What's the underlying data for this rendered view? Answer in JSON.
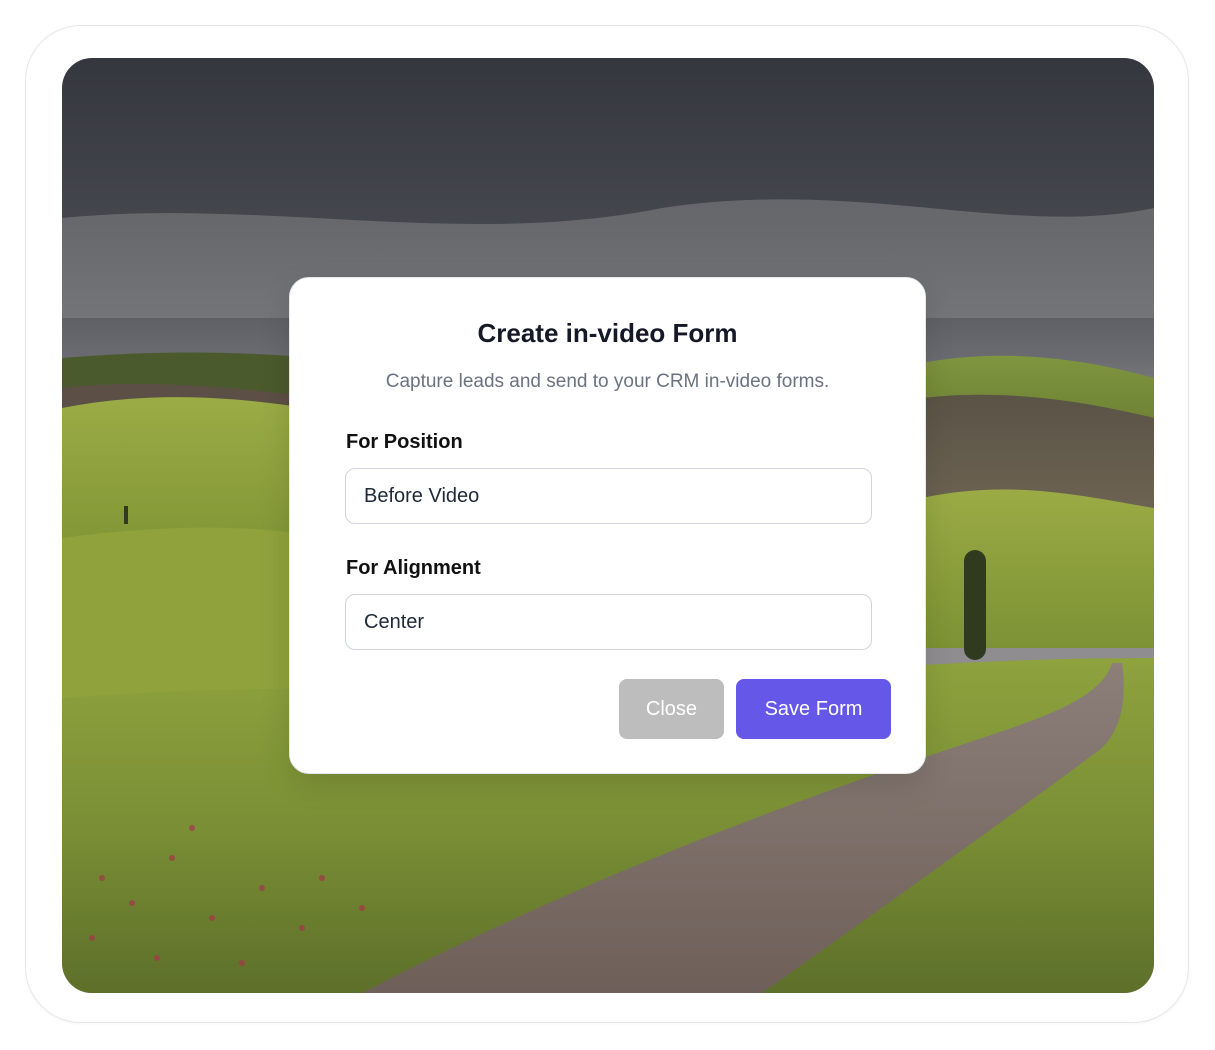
{
  "modal": {
    "title": "Create in-video Form",
    "subtitle": "Capture leads and send to your CRM in-video forms.",
    "position_field": {
      "label": "For Position",
      "value": "Before Video"
    },
    "alignment_field": {
      "label": "For Alignment",
      "value": "Center"
    },
    "close_label": "Close",
    "save_label": "Save Form"
  },
  "colors": {
    "primary": "#6558e8",
    "close_button": "#bdbdbd",
    "title": "#151826",
    "subtitle": "#6b7280"
  }
}
